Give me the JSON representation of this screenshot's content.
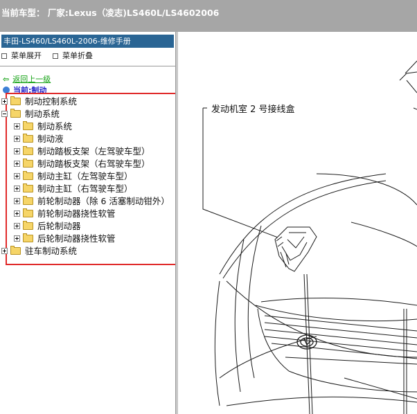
{
  "header": {
    "label": "当前车型： 厂家:Lexus（凌志)LS460L/LS4602006"
  },
  "manual": {
    "title": "丰田-LS460/LS460L-2006-维修手册",
    "expand_all": "菜单展开",
    "collapse_all": "菜单折叠",
    "back_link": "返回上一级",
    "current_node": "当前:制动"
  },
  "tree": [
    {
      "label": "制动控制系统",
      "level": 0,
      "expanded": false
    },
    {
      "label": "制动系统",
      "level": 0,
      "expanded": true
    },
    {
      "label": "制动系统",
      "level": 1,
      "expanded": false
    },
    {
      "label": "制动液",
      "level": 1,
      "expanded": false
    },
    {
      "label": "制动踏板支架（左驾驶车型）",
      "level": 1,
      "expanded": false
    },
    {
      "label": "制动踏板支架（右驾驶车型）",
      "level": 1,
      "expanded": false
    },
    {
      "label": "制动主缸（左驾驶车型）",
      "level": 1,
      "expanded": false
    },
    {
      "label": "制动主缸（右驾驶车型）",
      "level": 1,
      "expanded": false
    },
    {
      "label": "前轮制动器（除 6 活塞制动钳外）",
      "level": 1,
      "expanded": false
    },
    {
      "label": "前轮制动器挠性软管",
      "level": 1,
      "expanded": false
    },
    {
      "label": "后轮制动器",
      "level": 1,
      "expanded": false
    },
    {
      "label": "后轮制动器挠性软管",
      "level": 1,
      "expanded": false
    },
    {
      "label": "驻车制动系统",
      "level": 0,
      "expanded": false
    }
  ],
  "diagram": {
    "callout": "发动机室 2 号接线盒"
  },
  "colors": {
    "title_bar": "#a6a6a6",
    "manual_title_bg": "#2a6594",
    "highlight_border": "#e02a2a",
    "back_link": "#10a010",
    "current_node": "#1b1bc7"
  },
  "icons": [
    "arrow-left-icon",
    "globe-icon",
    "folder-icon",
    "expander-plus-icon",
    "expander-minus-icon"
  ]
}
